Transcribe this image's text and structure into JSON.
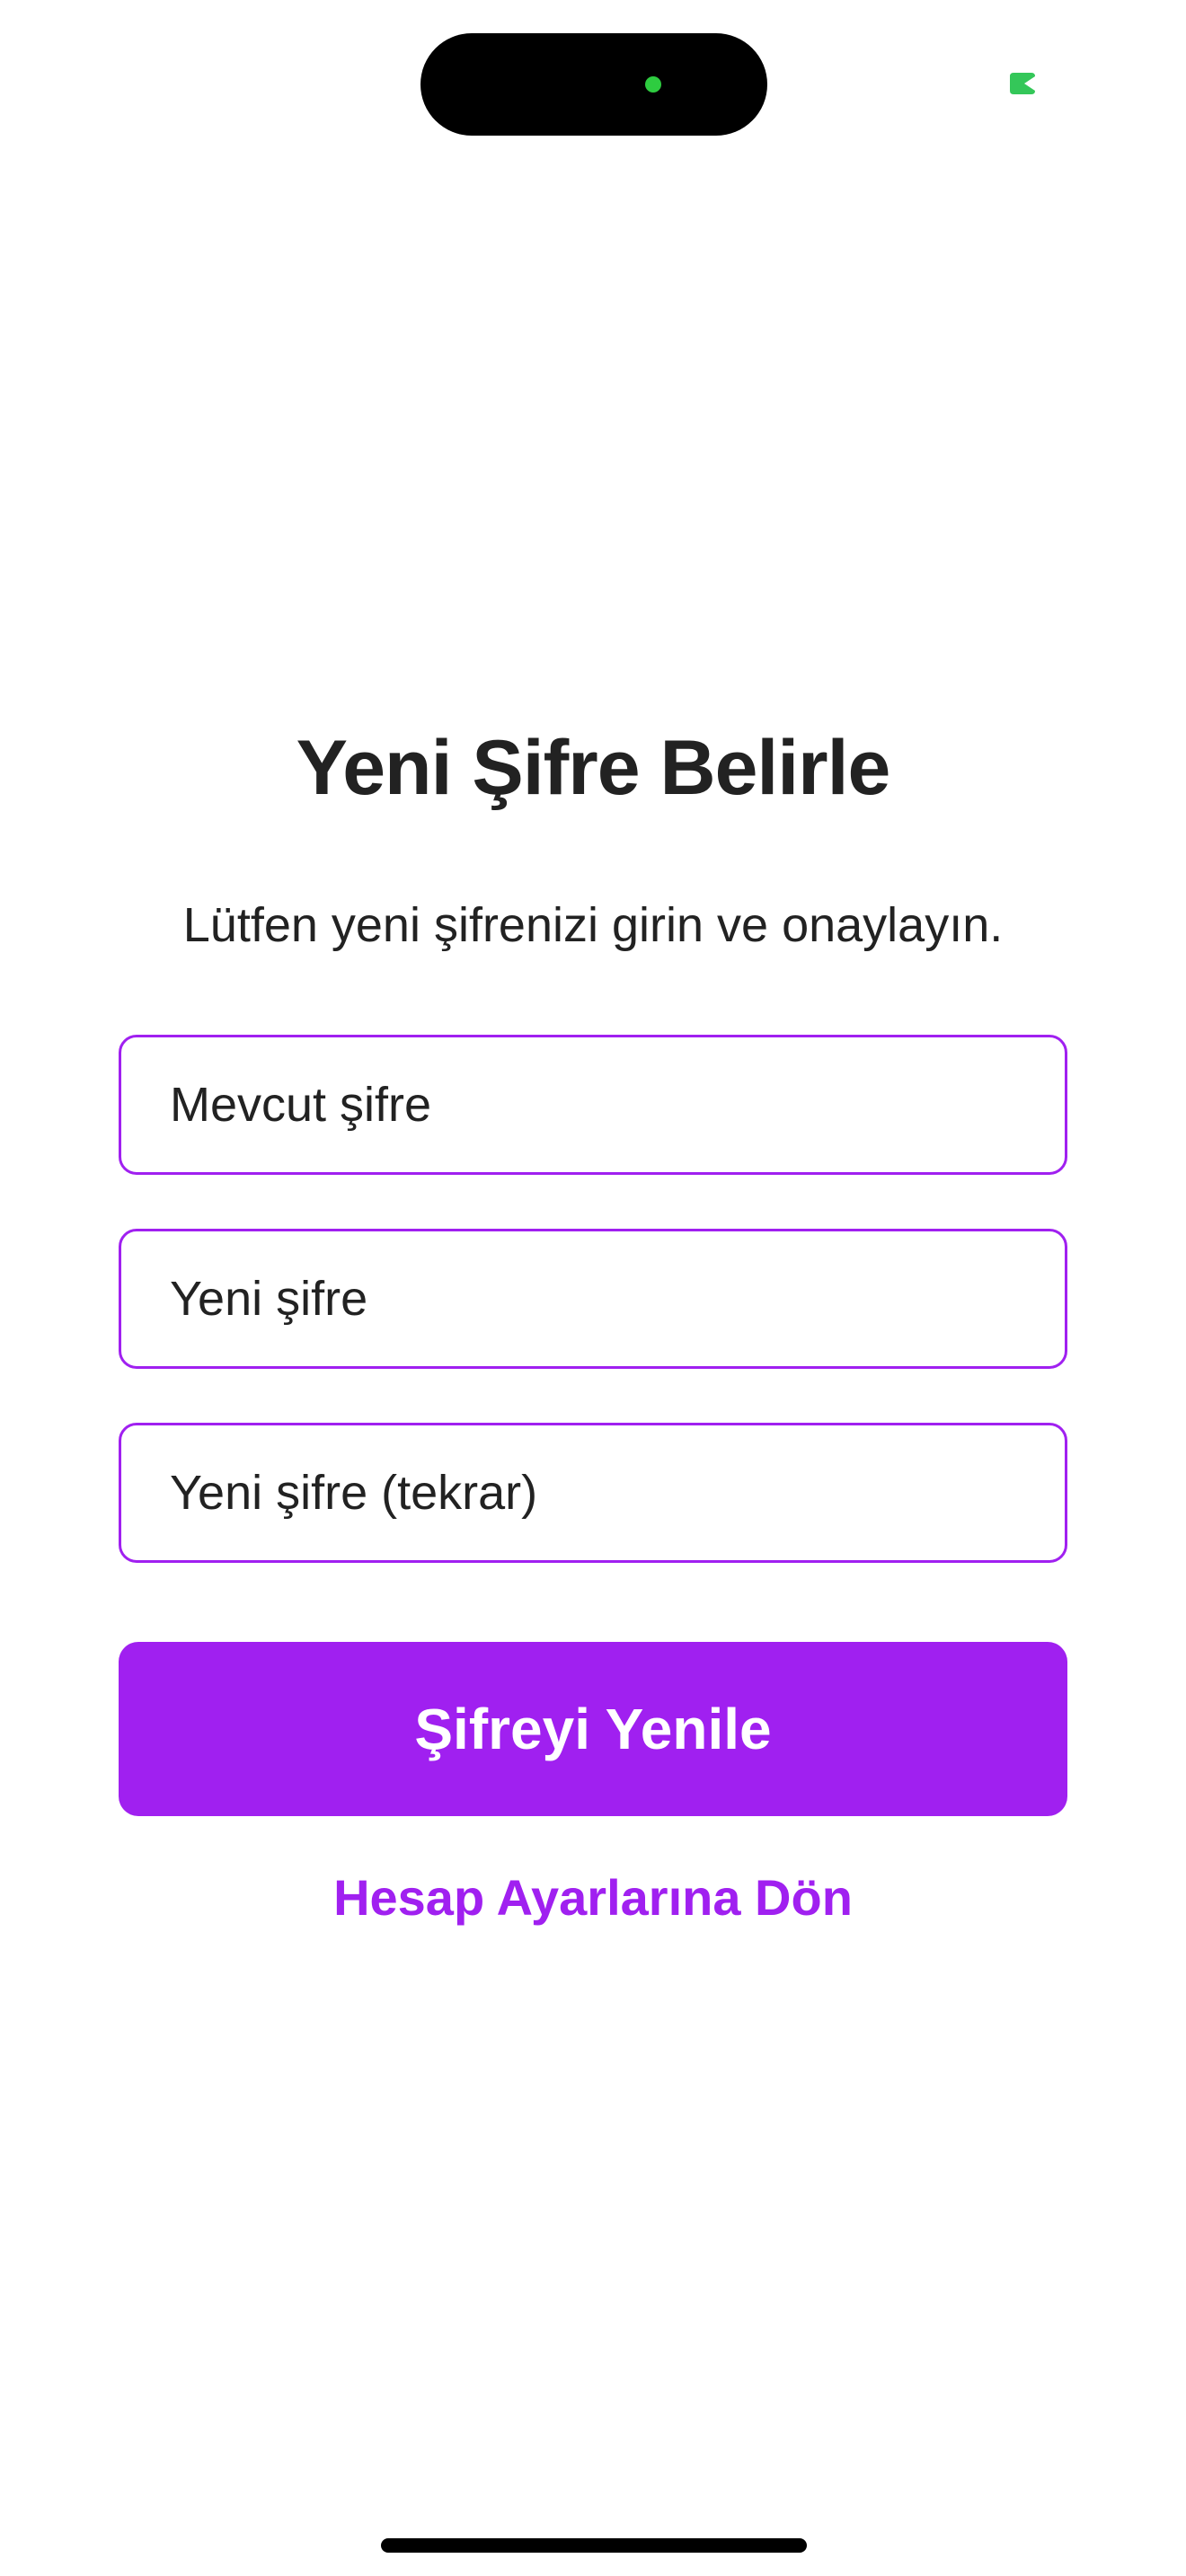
{
  "status_bar": {
    "indicator_icon": "camera-in-use-indicator",
    "indicator_color": "#34c759"
  },
  "form": {
    "title": "Yeni Şifre Belirle",
    "subtitle": "Lütfen yeni şifrenizi girin ve onaylayın.",
    "current_password": {
      "placeholder": "Mevcut şifre",
      "value": ""
    },
    "new_password": {
      "placeholder": "Yeni şifre",
      "value": ""
    },
    "confirm_password": {
      "placeholder": "Yeni şifre (tekrar)",
      "value": ""
    },
    "submit_label": "Şifreyi Yenile",
    "back_link_label": "Hesap Ayarlarına Dön"
  },
  "colors": {
    "accent": "#a020f0",
    "text": "#222222",
    "background": "#ffffff"
  }
}
